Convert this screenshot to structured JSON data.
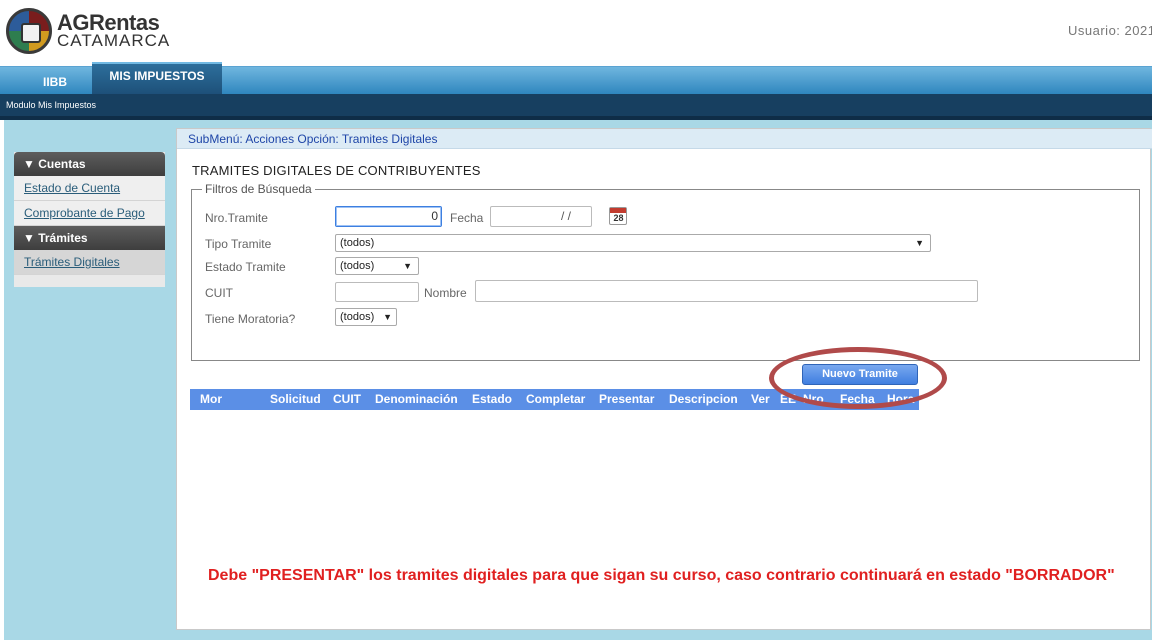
{
  "header": {
    "brand_top": "AGRentas",
    "brand_bottom": "CATAMARCA",
    "user_label": "Usuario: 2021"
  },
  "nav": {
    "tabs": [
      {
        "label": "IIBB",
        "active": false
      },
      {
        "label": "MIS IMPUESTOS",
        "active": true
      }
    ],
    "subbar": "Modulo Mis Impuestos"
  },
  "sidebar": {
    "sections": [
      {
        "title": "▼ Cuentas",
        "items": [
          "Estado de Cuenta",
          "Comprobante de Pago"
        ]
      },
      {
        "title": "▼ Trámites",
        "items": [
          "Trámites Digitales"
        ]
      }
    ]
  },
  "panel": {
    "submenu": "SubMenú: Acciones Opción: Tramites Digitales",
    "title": "TRAMITES DIGITALES DE CONTRIBUYENTES",
    "filters": {
      "legend": "Filtros de Búsqueda",
      "nro_tramite_label": "Nro.Tramite",
      "nro_tramite_value": "0",
      "fecha_label": "Fecha",
      "fecha_value": "/ /",
      "calendar_day": "28",
      "tipo_label": "Tipo Tramite",
      "tipo_value": "(todos)",
      "estado_label": "Estado Tramite",
      "estado_value": "(todos)",
      "cuit_label": "CUIT",
      "nombre_label": "Nombre",
      "moratoria_label": "Tiene Moratoria?",
      "moratoria_value": "(todos)"
    },
    "new_button": "Nuevo Tramite",
    "columns": [
      "Mor",
      "Solicitud",
      "CUIT",
      "Denominación",
      "Estado",
      "Completar",
      "Presentar",
      "Descripcion",
      "Ver",
      "EE",
      "Nro",
      "Fecha",
      "Hora"
    ],
    "warning": "Debe \"PRESENTAR\" los tramites digitales para que sigan su curso, caso contrario continuará en estado \"BORRADOR\""
  },
  "colors": {
    "nav_blue": "#2f86be",
    "dark_blue": "#173f60",
    "canvas": "#a9d8e6",
    "table_header": "#5b8fe6",
    "warning_red": "#e02020",
    "highlight_ring": "#b04a4a"
  }
}
